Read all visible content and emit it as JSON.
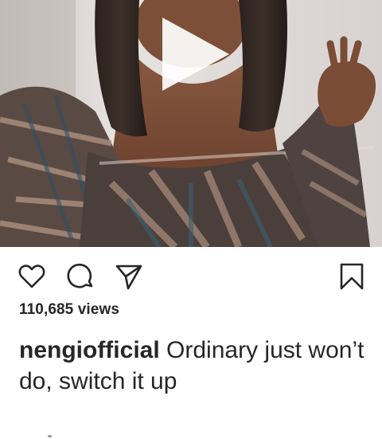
{
  "post": {
    "views_count": "110,685",
    "views_label": "views",
    "username": "nengiofficial",
    "caption": "Ordinary just won’t do, switch it up"
  },
  "icons": {
    "play": "play-icon",
    "like": "heart-icon",
    "comment": "comment-icon",
    "share": "send-icon",
    "save": "bookmark-icon"
  }
}
